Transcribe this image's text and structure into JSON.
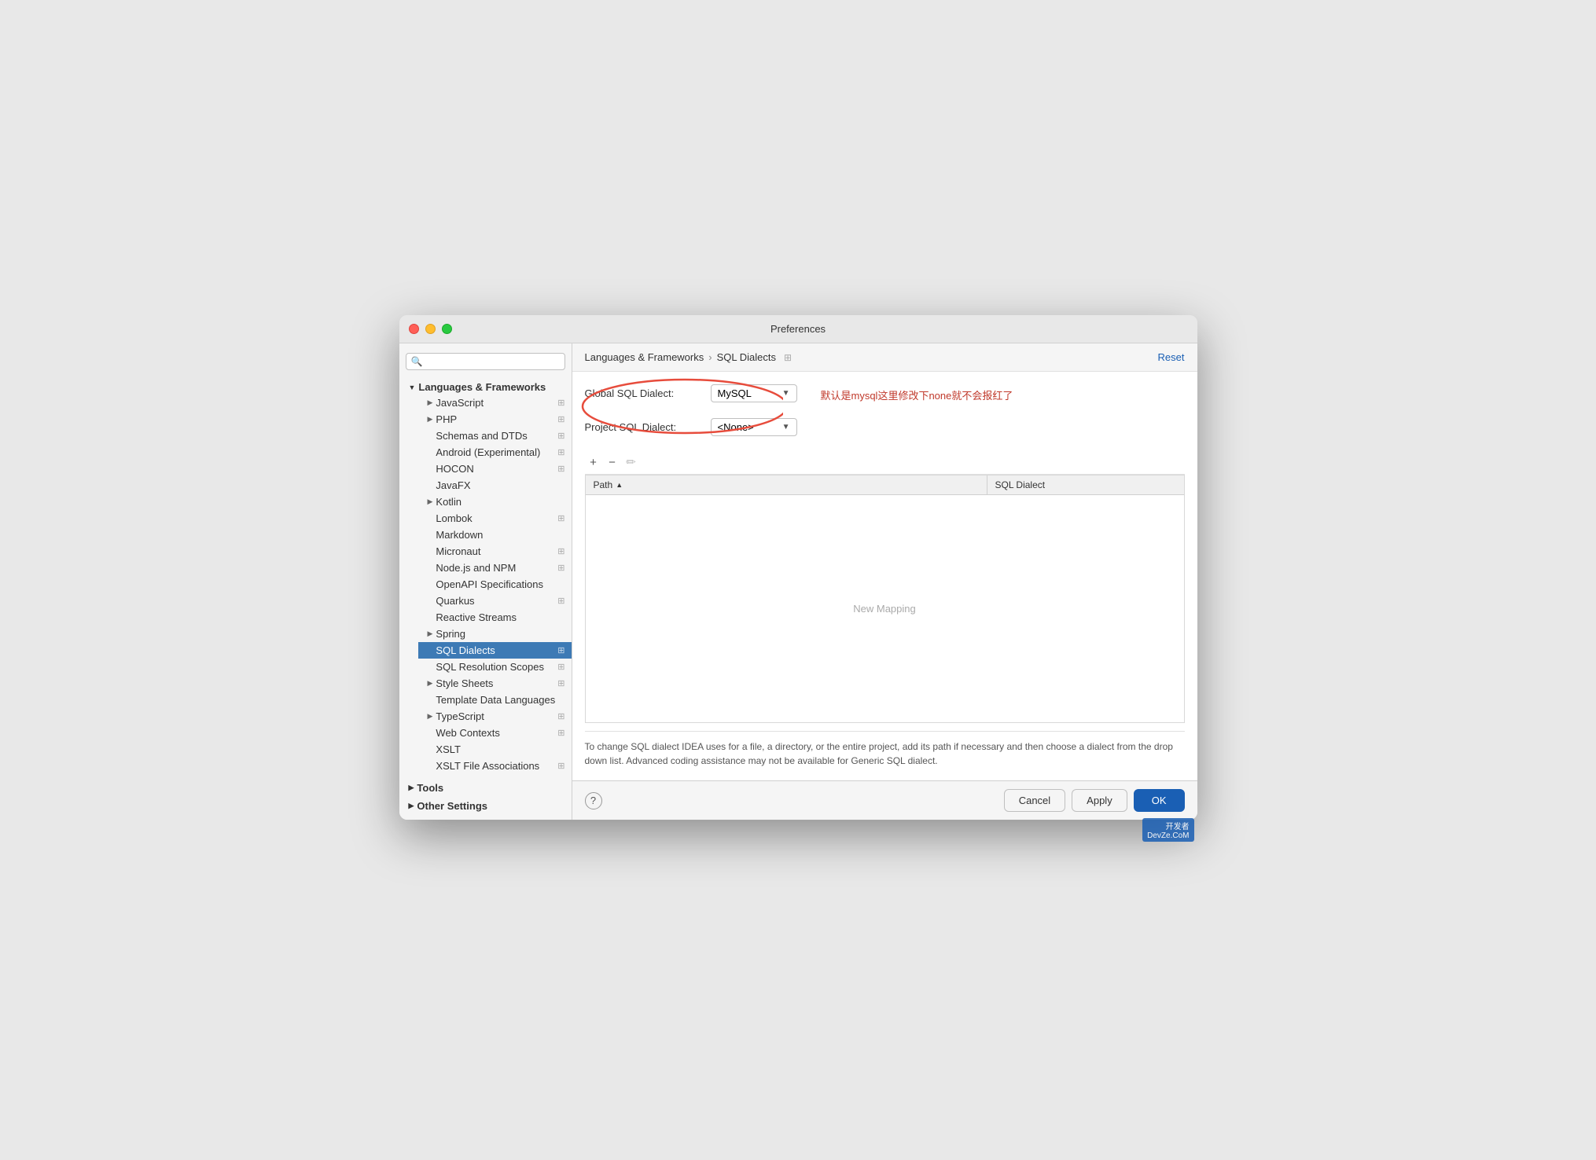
{
  "window": {
    "title": "Preferences"
  },
  "header": {
    "breadcrumb_parent": "Languages & Frameworks",
    "breadcrumb_sep": "›",
    "breadcrumb_current": "SQL Dialects",
    "reset_label": "Reset"
  },
  "search": {
    "placeholder": "🔍"
  },
  "sidebar": {
    "group_label": "Languages & Frameworks",
    "items": [
      {
        "id": "javascript",
        "label": "JavaScript",
        "has_arrow": true,
        "has_icon": false,
        "indented": true
      },
      {
        "id": "php",
        "label": "PHP",
        "has_arrow": true,
        "has_icon": false,
        "indented": true
      },
      {
        "id": "schemas-dtds",
        "label": "Schemas and DTDs",
        "has_arrow": false,
        "has_icon": false,
        "indented": true
      },
      {
        "id": "android",
        "label": "Android (Experimental)",
        "has_arrow": false,
        "has_icon": false,
        "indented": true
      },
      {
        "id": "hocon",
        "label": "HOCON",
        "has_arrow": false,
        "has_icon": false,
        "indented": true
      },
      {
        "id": "javafx",
        "label": "JavaFX",
        "has_arrow": false,
        "has_icon": false,
        "indented": true
      },
      {
        "id": "kotlin",
        "label": "Kotlin",
        "has_arrow": true,
        "has_icon": false,
        "indented": true
      },
      {
        "id": "lombok",
        "label": "Lombok",
        "has_arrow": false,
        "has_icon": false,
        "indented": true
      },
      {
        "id": "markdown",
        "label": "Markdown",
        "has_arrow": false,
        "has_icon": false,
        "indented": true
      },
      {
        "id": "micronaut",
        "label": "Micronaut",
        "has_arrow": false,
        "has_icon": false,
        "indented": true
      },
      {
        "id": "nodejs-npm",
        "label": "Node.js and NPM",
        "has_arrow": false,
        "has_icon": false,
        "indented": true
      },
      {
        "id": "openapi",
        "label": "OpenAPI Specifications",
        "has_arrow": false,
        "has_icon": false,
        "indented": true
      },
      {
        "id": "quarkus",
        "label": "Quarkus",
        "has_arrow": false,
        "has_icon": false,
        "indented": true
      },
      {
        "id": "reactive-streams",
        "label": "Reactive Streams",
        "has_arrow": false,
        "has_icon": false,
        "indented": true
      },
      {
        "id": "spring",
        "label": "Spring",
        "has_arrow": true,
        "has_icon": false,
        "indented": true
      },
      {
        "id": "sql-dialects",
        "label": "SQL Dialects",
        "active": true,
        "has_arrow": false,
        "has_icon": false,
        "indented": true
      },
      {
        "id": "sql-resolution",
        "label": "SQL Resolution Scopes",
        "has_arrow": false,
        "has_icon": false,
        "indented": true
      },
      {
        "id": "style-sheets",
        "label": "Style Sheets",
        "has_arrow": true,
        "has_icon": false,
        "indented": true
      },
      {
        "id": "template-data",
        "label": "Template Data Languages",
        "has_arrow": false,
        "has_icon": false,
        "indented": true
      },
      {
        "id": "typescript",
        "label": "TypeScript",
        "has_arrow": true,
        "has_icon": false,
        "indented": true
      },
      {
        "id": "web-contexts",
        "label": "Web Contexts",
        "has_arrow": false,
        "has_icon": false,
        "indented": true
      },
      {
        "id": "xslt",
        "label": "XSLT",
        "has_arrow": false,
        "has_icon": false,
        "indented": true
      },
      {
        "id": "xslt-file",
        "label": "XSLT File Associations",
        "has_arrow": false,
        "has_icon": false,
        "indented": true
      }
    ],
    "bottom_groups": [
      {
        "id": "tools",
        "label": "Tools",
        "has_arrow": true
      },
      {
        "id": "other-settings",
        "label": "Other Settings",
        "has_arrow": true
      }
    ]
  },
  "main": {
    "global_dialect_label": "Global SQL Dialect:",
    "global_dialect_value": "MySQL",
    "project_dialect_label": "Project SQL Dialect:",
    "project_dialect_value": "<None>",
    "annotation": "默认是mysql这里修改下none就不会报红了",
    "table": {
      "col_path": "Path",
      "col_dialect": "SQL Dialect",
      "empty_text": "New Mapping"
    },
    "info_text": "To change SQL dialect IDEA uses for a file, a directory, or the entire project, add its path if necessary and then choose a dialect from the drop down list. Advanced coding assistance may not be available for Generic SQL dialect."
  },
  "footer": {
    "cancel_label": "Cancel",
    "apply_label": "Apply",
    "ok_label": "OK"
  },
  "watermark": "开发者\nDevZe.CoM"
}
